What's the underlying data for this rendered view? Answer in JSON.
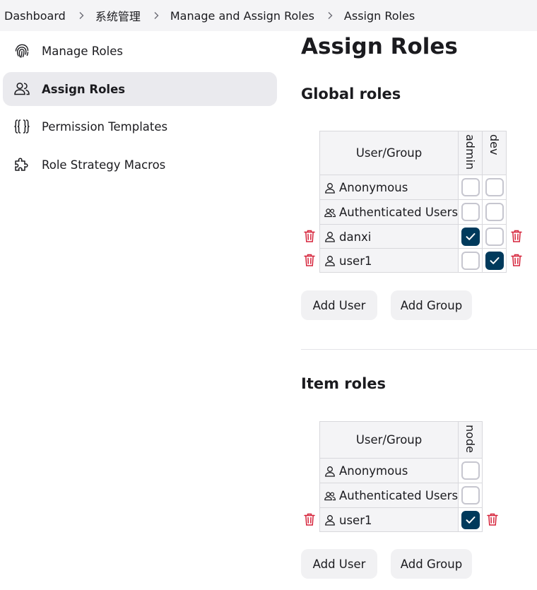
{
  "breadcrumb": [
    "Dashboard",
    "系统管理",
    "Manage and Assign Roles",
    "Assign Roles"
  ],
  "sidebar": {
    "items": [
      {
        "label": "Manage Roles",
        "icon": "fingerprint-icon",
        "active": false
      },
      {
        "label": "Assign Roles",
        "icon": "users-icon",
        "active": true
      },
      {
        "label": "Permission Templates",
        "icon": "braces-icon",
        "active": false
      },
      {
        "label": "Role Strategy Macros",
        "icon": "puzzle-icon",
        "active": false
      }
    ]
  },
  "page_title": "Assign Roles",
  "global": {
    "title": "Global roles",
    "column_header": "User/Group",
    "roles": [
      "admin",
      "dev"
    ],
    "rows": [
      {
        "name": "Anonymous",
        "type": "user",
        "checks": [
          false,
          false
        ],
        "deletable": false
      },
      {
        "name": "Authenticated Users",
        "type": "group",
        "checks": [
          false,
          false
        ],
        "deletable": false
      },
      {
        "name": "danxi",
        "type": "user",
        "checks": [
          true,
          false
        ],
        "deletable": true
      },
      {
        "name": "user1",
        "type": "user",
        "checks": [
          false,
          true
        ],
        "deletable": true
      }
    ],
    "add_user": "Add User",
    "add_group": "Add Group"
  },
  "item": {
    "title": "Item roles",
    "column_header": "User/Group",
    "roles": [
      "node"
    ],
    "rows": [
      {
        "name": "Anonymous",
        "type": "user",
        "checks": [
          false
        ],
        "deletable": false
      },
      {
        "name": "Authenticated Users",
        "type": "group",
        "checks": [
          false
        ],
        "deletable": false
      },
      {
        "name": "user1",
        "type": "user",
        "checks": [
          true
        ],
        "deletable": true
      }
    ],
    "add_user": "Add User",
    "add_group": "Add Group"
  },
  "colors": {
    "accent": "#003a5c",
    "delete": "#d6243b",
    "panel": "#f4f4f6"
  }
}
